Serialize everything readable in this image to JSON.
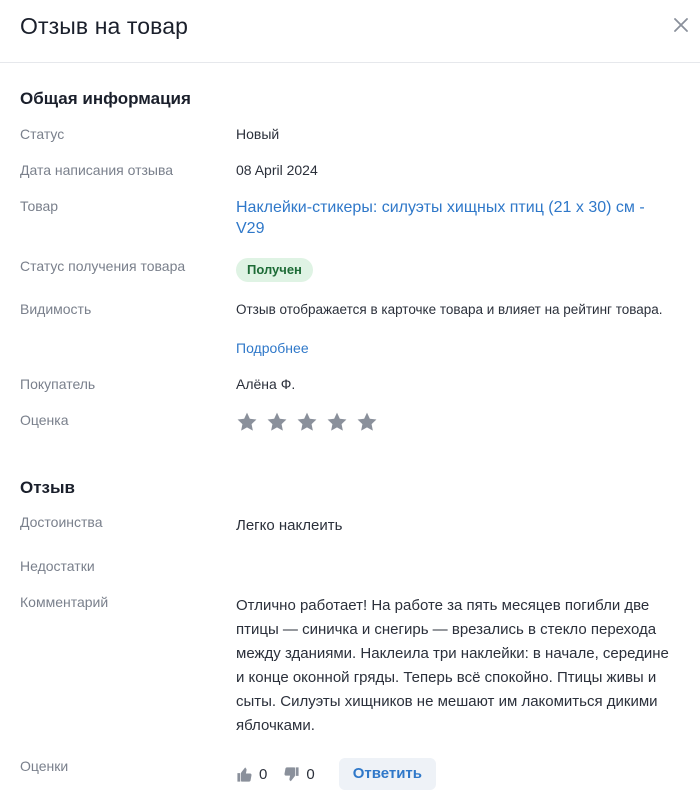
{
  "header": {
    "title": "Отзыв на товар"
  },
  "general": {
    "title": "Общая информация",
    "status_label": "Статус",
    "status_value": "Новый",
    "date_label": "Дата написания отзыва",
    "date_value": "08 April 2024",
    "product_label": "Товар",
    "product_value": "Наклейки-стикеры: силуэты хищных птиц (21 х 30) см - V29",
    "receipt_label": "Статус получения товара",
    "receipt_value": "Получен",
    "visibility_label": "Видимость",
    "visibility_value": "Отзыв отображается в карточке товара и влияет на рейтинг товара.",
    "visibility_more": "Подробнее",
    "buyer_label": "Покупатель",
    "buyer_value": "Алёна Ф.",
    "rating_label": "Оценка",
    "rating_stars_filled": 0,
    "rating_stars_total": 5
  },
  "review": {
    "title": "Отзыв",
    "pros_label": "Достоинства",
    "pros_value": "Легко наклеить",
    "cons_label": "Недостатки",
    "cons_value": "",
    "comment_label": "Комментарий",
    "comment_value": "Отлично работает! На работе за пять месяцев погибли две птицы — синичка и снегирь — врезались в стекло перехода между зданиями. Наклеила три наклейки: в начале, середине и конце оконной гряды. Теперь всё спокойно. Птицы живы и сыты. Силуэты хищников не мешают им лакомиться дикими яблочками.",
    "votes_label": "Оценки",
    "likes": "0",
    "dislikes": "0",
    "reply_button": "Ответить"
  },
  "colors": {
    "link": "#2f78c9",
    "badge_bg": "#dff3e4",
    "badge_text": "#1d6b36",
    "star": "#8a909b",
    "label": "#7a808c"
  },
  "icons": {
    "close": "close-icon",
    "star": "star-icon",
    "like": "thumbs-up-icon",
    "dislike": "thumbs-down-icon"
  }
}
